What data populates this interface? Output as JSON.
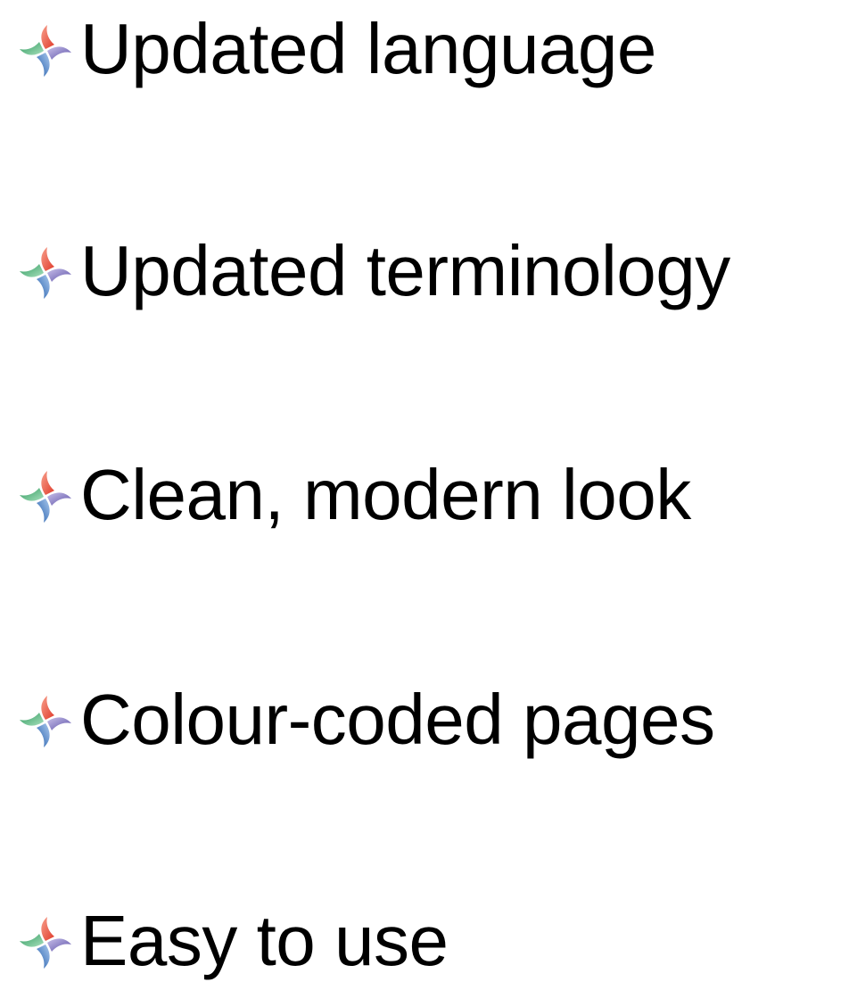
{
  "bullet_icon": "pinwheel-icon",
  "colors": {
    "blade_red": "#e8493a",
    "blade_purple": "#6b5fae",
    "blade_blue": "#2e6db6",
    "blade_green": "#3fa86e",
    "text": "#000000"
  },
  "items": [
    {
      "text": "Updated language"
    },
    {
      "text": "Updated terminology"
    },
    {
      "text": "Clean, modern look"
    },
    {
      "text": "Colour-coded pages"
    },
    {
      "text": "Easy to use"
    }
  ]
}
